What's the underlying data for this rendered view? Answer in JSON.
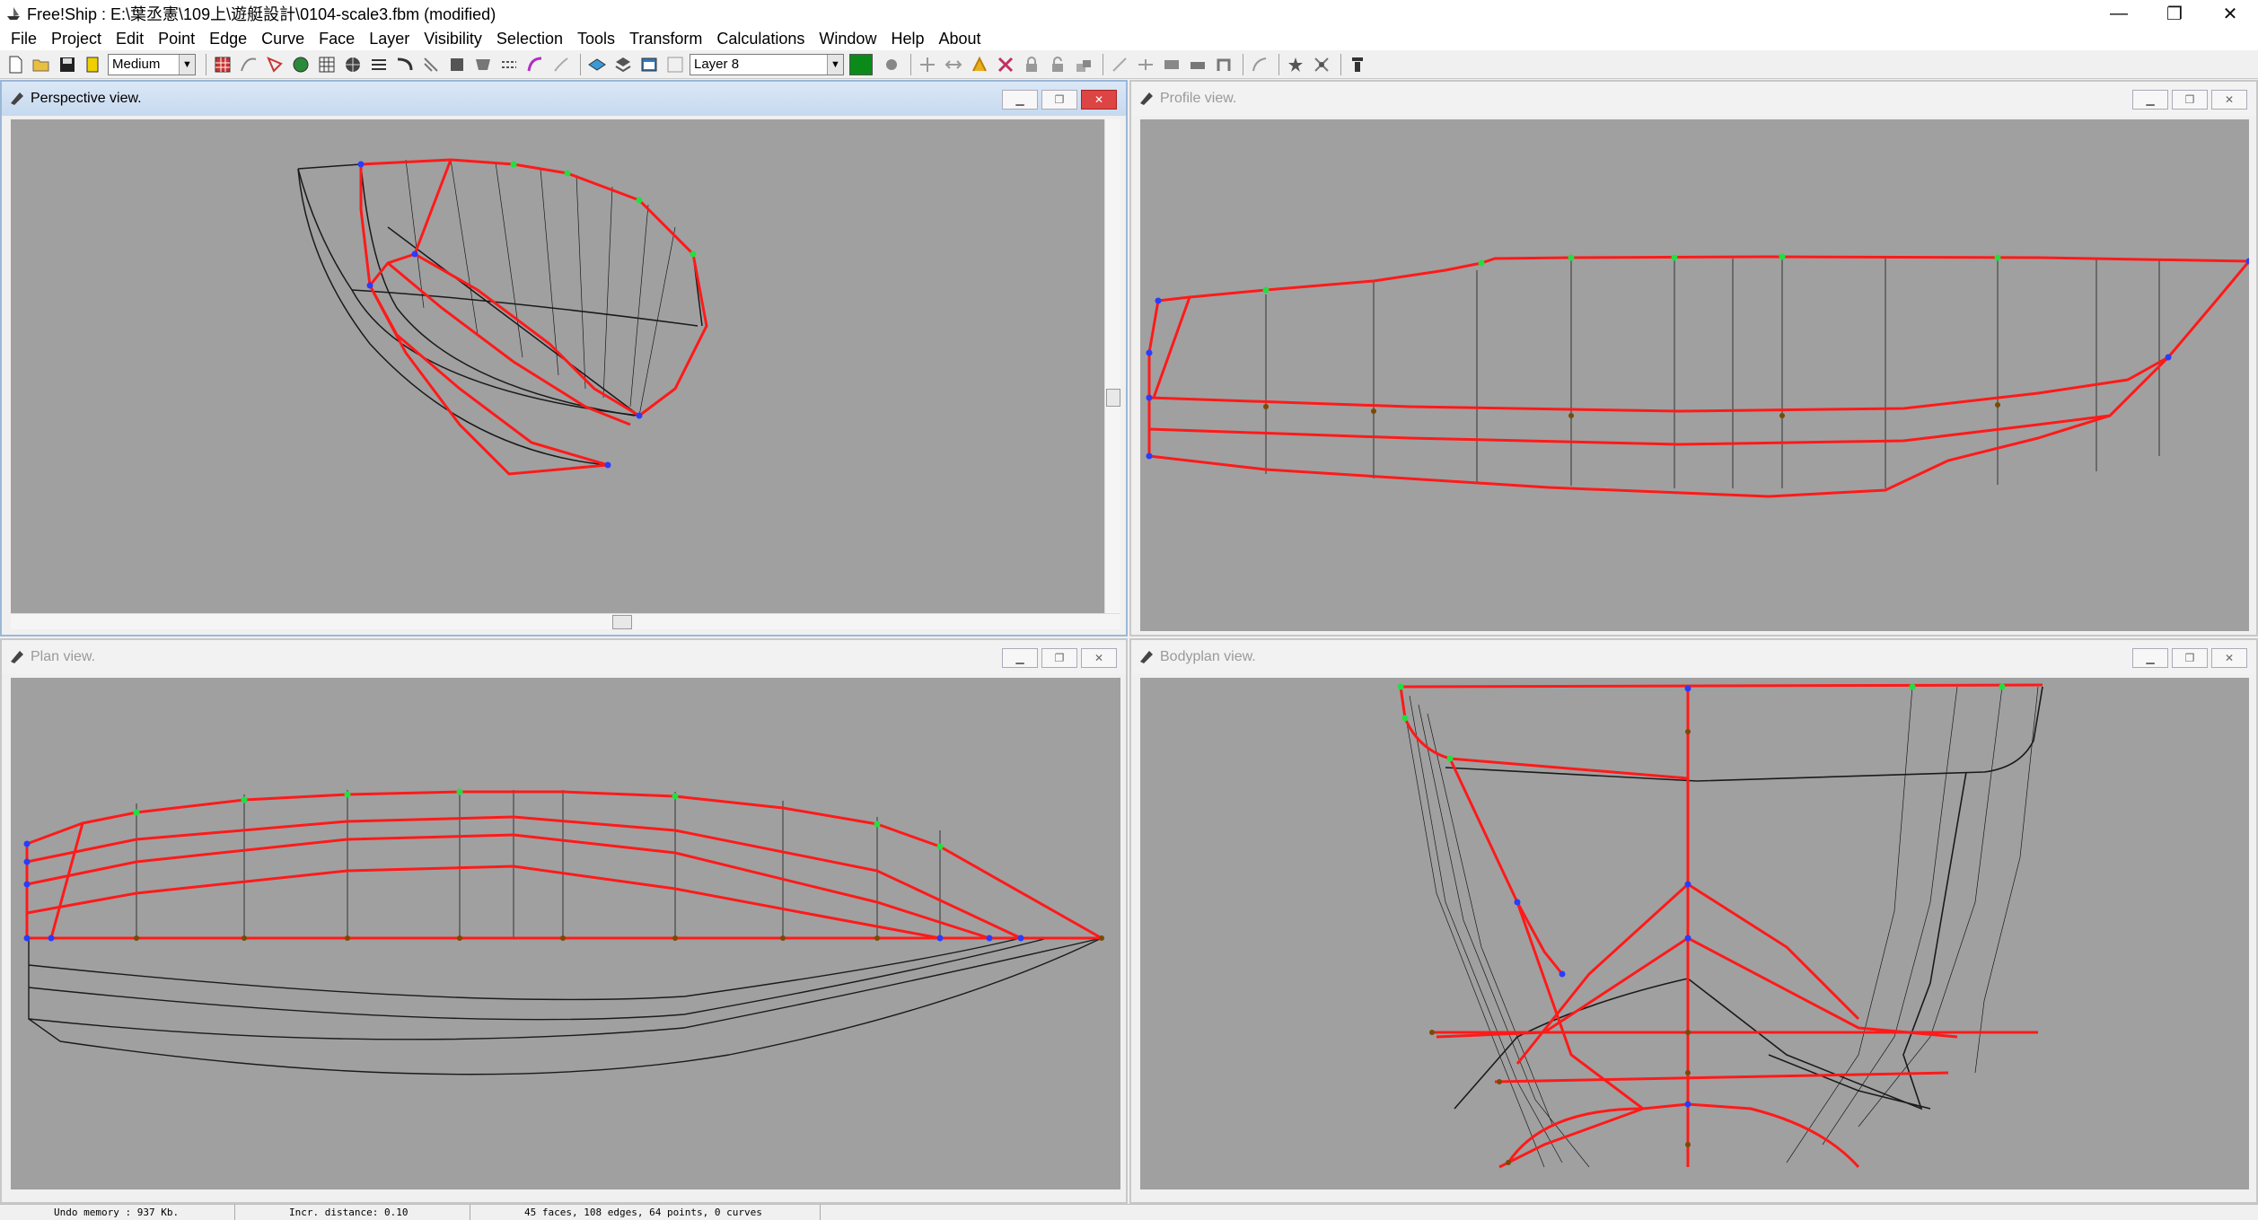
{
  "window": {
    "title": "Free!Ship : E:\\葉丞憲\\109上\\遊艇設計\\0104-scale3.fbm (modified)",
    "minimize": "—",
    "maximize": "❐",
    "close": "✕"
  },
  "menu": [
    "File",
    "Project",
    "Edit",
    "Point",
    "Edge",
    "Curve",
    "Face",
    "Layer",
    "Visibility",
    "Selection",
    "Tools",
    "Transform",
    "Calculations",
    "Window",
    "Help",
    "About"
  ],
  "toolbar": {
    "precision_value": "Medium",
    "layer_value": "Layer 8",
    "layer_color": "#0b8a1a"
  },
  "views": {
    "perspective": {
      "title": "Perspective view."
    },
    "profile": {
      "title": "Profile view."
    },
    "plan": {
      "title": "Plan view."
    },
    "bodyplan": {
      "title": "Bodyplan view."
    }
  },
  "status": {
    "undo": "Undo memory : 937 Kb.",
    "incr": "Incr. distance: 0.10",
    "counts": "45 faces, 108 edges, 64 points, 0 curves"
  },
  "colors": {
    "viewport_bg": "#a0a0a0",
    "edge_red": "#ff1a1a",
    "edge_black": "#1a1a1a",
    "point_blue": "#2a3cff",
    "point_green": "#20e040",
    "point_brown": "#7a4a00"
  }
}
